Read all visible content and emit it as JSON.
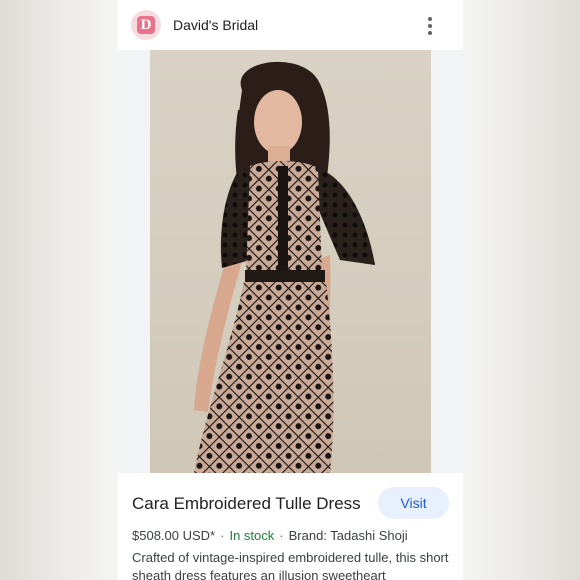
{
  "header": {
    "logo_letter": "D",
    "site_name": "David's Bridal",
    "menu_icon": "more-vert-icon"
  },
  "product": {
    "title": "Cara Embroidered Tulle Dress",
    "visit_label": "Visit",
    "price": "$508.00 USD*",
    "separator": "·",
    "stock": "In stock",
    "brand": "Brand: Tadashi Shoji",
    "description": "Crafted of vintage-inspired embroidered tulle, this short sheath dress features an illusion sweetheart"
  },
  "colors": {
    "logo_bg": "#f4dcdf",
    "logo_mark": "#e8738a",
    "visit_bg": "#e8f0fe",
    "visit_text": "#1a5fd6",
    "stock_text": "#188038"
  }
}
